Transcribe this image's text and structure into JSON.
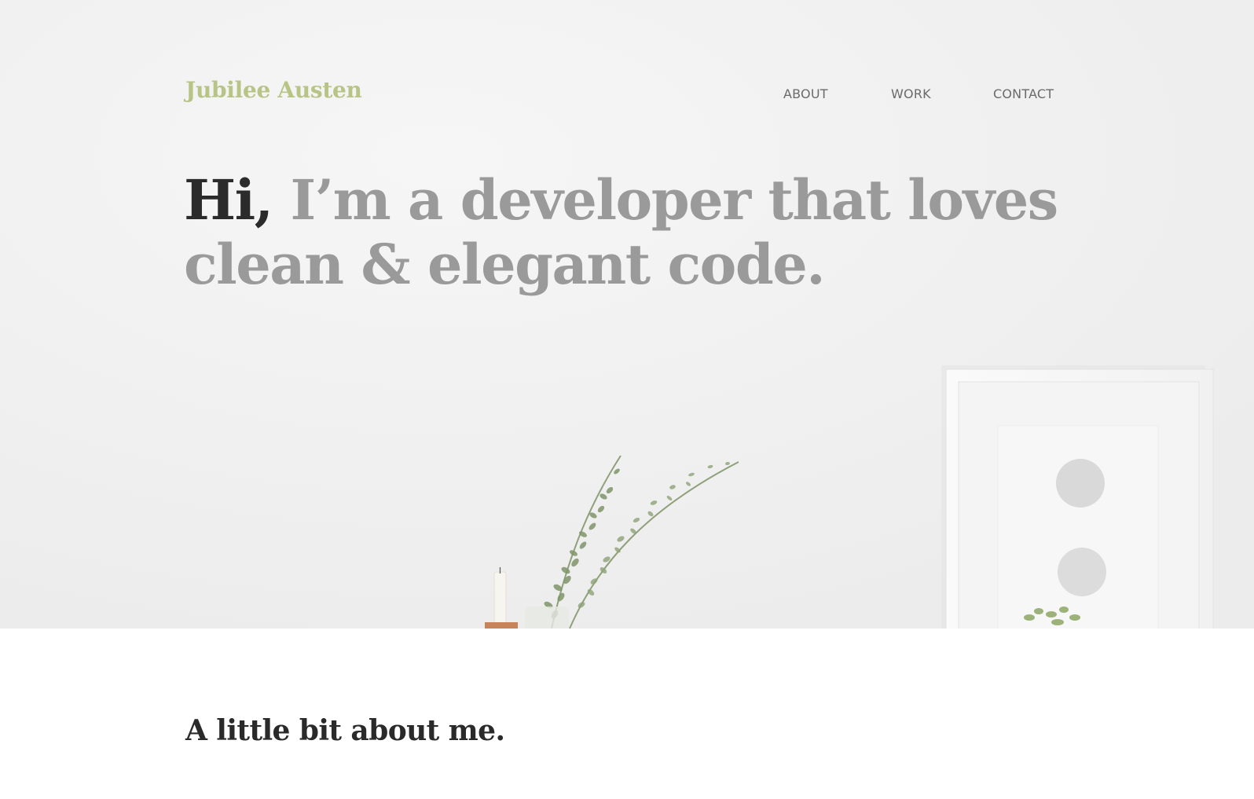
{
  "header": {
    "logo": "Jubilee Austen",
    "nav": [
      {
        "label": "ABOUT"
      },
      {
        "label": "WORK"
      },
      {
        "label": "CONTACT"
      }
    ]
  },
  "hero": {
    "greeting": "Hi,",
    "tagline_line1": " I’m a developer that loves",
    "tagline_line2": "clean & elegant code."
  },
  "about": {
    "title": "A little bit about me."
  },
  "colors": {
    "accent": "#b7c486",
    "headline_muted": "#9a9a9a",
    "headline_dark": "#2b2b2b",
    "nav_text": "#6a6a6a"
  }
}
